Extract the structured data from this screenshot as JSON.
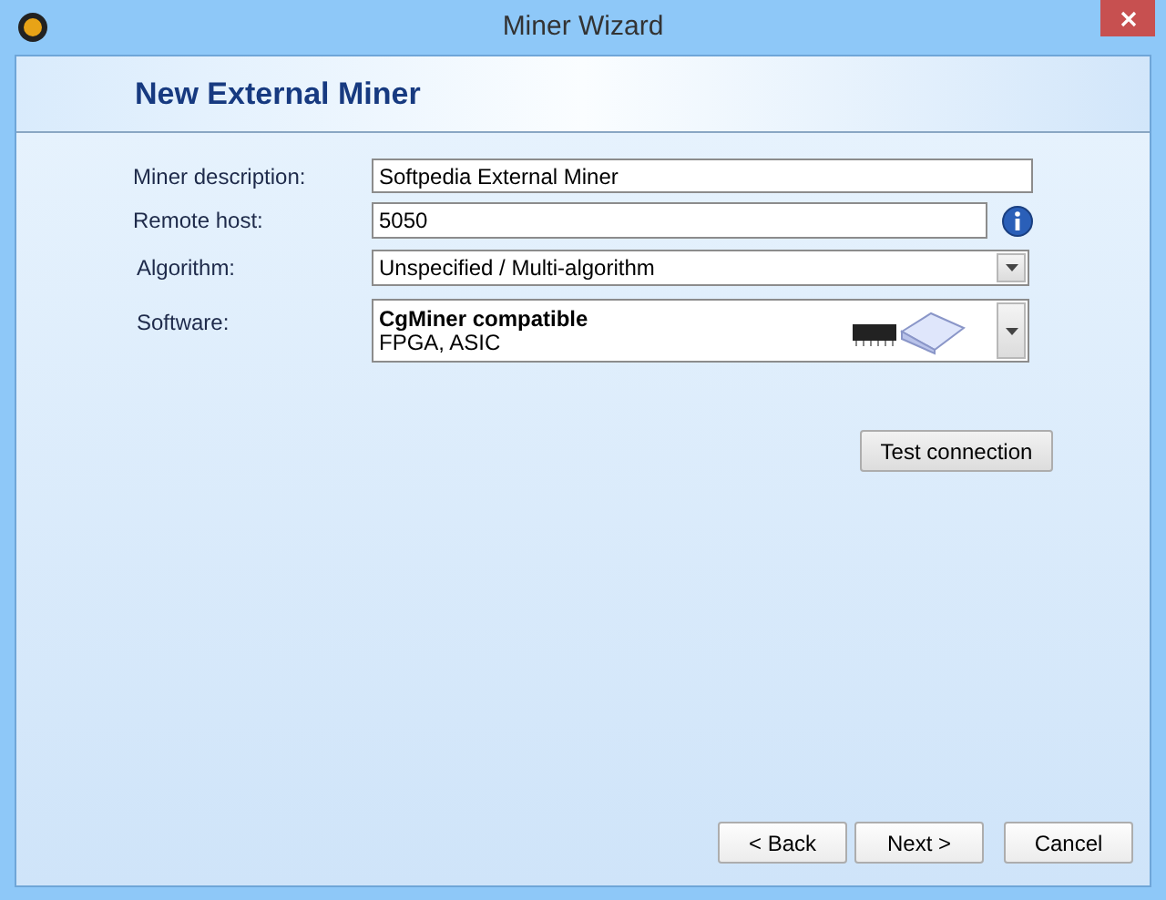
{
  "window": {
    "title": "Miner Wizard"
  },
  "header": {
    "title": "New External Miner"
  },
  "form": {
    "description": {
      "label": "Miner description:",
      "value": "Softpedia External Miner"
    },
    "remote_host": {
      "label": "Remote host:",
      "value": "5050"
    },
    "algorithm": {
      "label": "Algorithm:",
      "value": "Unspecified / Multi-algorithm"
    },
    "software": {
      "label": "Software:",
      "title": "CgMiner compatible",
      "subtitle": "FPGA, ASIC"
    }
  },
  "test_button": "Test connection",
  "buttons": [
    {
      "label": "< Back",
      "disabled": false
    },
    {
      "label": "Next >",
      "disabled": false
    },
    {
      "label": "Cancel",
      "disabled": false
    }
  ]
}
